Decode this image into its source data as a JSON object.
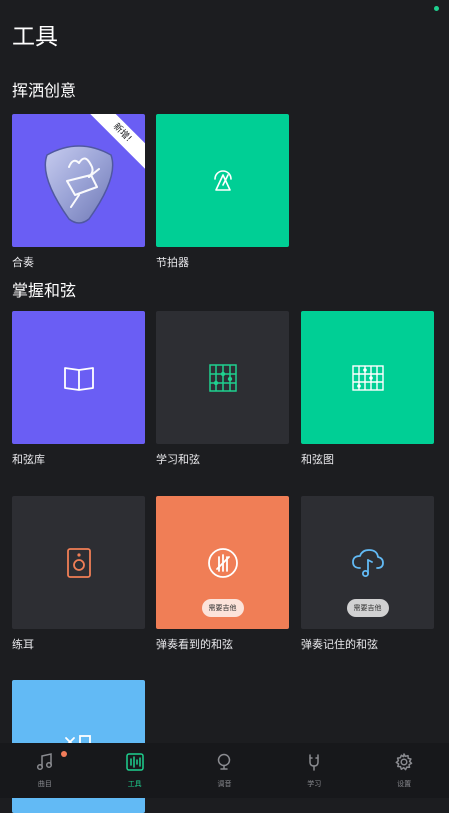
{
  "page": {
    "title": "工具"
  },
  "colors": {
    "background": "#1c1d20",
    "purple": "#6a5ef4",
    "green": "#00cf95",
    "dark_tile": "#2d2e33",
    "orange": "#f07e56",
    "sky": "#62baf5",
    "accent": "#1fd08f"
  },
  "sections": [
    {
      "title": "挥洒创意",
      "tiles": [
        {
          "label": "合奏",
          "icon": "guitar-pick-icon",
          "ribbon": "新增!"
        },
        {
          "label": "节拍器",
          "icon": "metronome-icon"
        }
      ]
    },
    {
      "title": "掌握和弦",
      "tiles": [
        {
          "label": "和弦库",
          "icon": "book-icon"
        },
        {
          "label": "学习和弦",
          "icon": "chord-grid-icon"
        },
        {
          "label": "和弦图",
          "icon": "chord-chart-icon"
        },
        {
          "label": "练耳",
          "icon": "speaker-icon"
        },
        {
          "label": "弹奏看到的和弦",
          "icon": "guitar-circle-icon",
          "pill": "需要吉他"
        },
        {
          "label": "弹奏记住的和弦",
          "icon": "cloud-music-icon",
          "pill": "需要吉他"
        },
        {
          "label": "",
          "icon": "x-square-icon"
        }
      ]
    }
  ],
  "nav": {
    "active": "工具",
    "items": [
      {
        "label": "曲目",
        "icon": "music-note-icon",
        "badge": true
      },
      {
        "label": "工具",
        "icon": "tools-icon"
      },
      {
        "label": "调音",
        "icon": "tuner-icon"
      },
      {
        "label": "学习",
        "icon": "learn-icon"
      },
      {
        "label": "设置",
        "icon": "gear-icon"
      }
    ]
  }
}
